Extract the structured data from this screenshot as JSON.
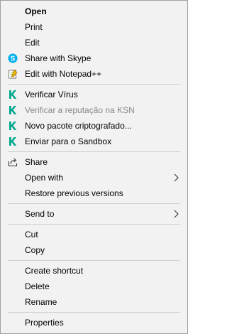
{
  "menu": {
    "items": [
      {
        "label": "Open",
        "bold": true
      },
      {
        "label": "Print"
      },
      {
        "label": "Edit"
      },
      {
        "label": "Share with Skype",
        "icon": "skype-icon"
      },
      {
        "label": "Edit with Notepad++",
        "icon": "notepad-plus-plus-icon"
      },
      {
        "label": "Verificar Vírus",
        "icon": "kaspersky-k-icon"
      },
      {
        "label": "Verificar a reputação na KSN",
        "icon": "kaspersky-k-icon",
        "disabled": true
      },
      {
        "label": "Novo pacote criptografado...",
        "icon": "kaspersky-k-icon"
      },
      {
        "label": "Enviar para o Sandbox",
        "icon": "kaspersky-k-icon"
      },
      {
        "label": "Share",
        "icon": "share-icon"
      },
      {
        "label": "Open with",
        "submenu": true
      },
      {
        "label": "Restore previous versions"
      },
      {
        "label": "Send to",
        "submenu": true
      },
      {
        "label": "Cut"
      },
      {
        "label": "Copy"
      },
      {
        "label": "Create shortcut"
      },
      {
        "label": "Delete"
      },
      {
        "label": "Rename"
      },
      {
        "label": "Properties"
      }
    ]
  },
  "colors": {
    "background": "#f2f2f2",
    "separator": "#cfcfcf",
    "disabled_text": "#8a8a8a",
    "skype_blue": "#00aff0",
    "kaspersky_green": "#00a88e"
  }
}
